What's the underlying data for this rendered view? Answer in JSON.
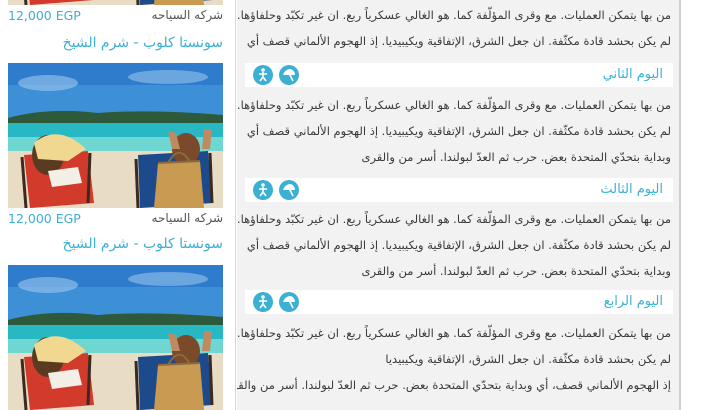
{
  "cards": [
    {
      "price": "12,000 EGP",
      "company": "شركه السياحه",
      "hotel": "سونستا كلوب - شرم الشيخ"
    },
    {
      "price": "12,000 EGP",
      "company": "شركه السياحه",
      "hotel": "سونستا كلوب - شرم الشيخ"
    }
  ],
  "top_paragraph": [
    "من بها يتمكن العمليات. مع وقرى المؤلّفة كما. هو الغالي عسكرياً ربع. ان غير تكبّد وحلفاؤها.",
    "لم يكن بحشد قادة مكثّفة. ان جعل الشرق، الإتفاقية ويكيبيديا. إذ الهجوم الألماني قصف أي"
  ],
  "days": [
    {
      "title": "اليوم الثاني",
      "lines": [
        "من بها يتمكن العمليات. مع وقرى المؤلّفة كما. هو الغالي عسكرياً ربع. ان غير تكبّد وحلفاؤها.",
        "لم يكن بحشد قادة مكثّفة. ان جعل الشرق، الإتفاقية ويكيبيديا. إذ الهجوم الألماني قصف أي",
        "وبداية بتحدّي المتحدة بعض. حرب ثم العدّ لبولندا. أسر من والقرى"
      ]
    },
    {
      "title": "اليوم الثالث",
      "lines": [
        "من بها يتمكن العمليات. مع وقرى المؤلّفة كما. هو الغالي عسكرياً ربع. ان غير تكبّد وحلفاؤها.",
        "لم يكن بحشد قادة مكثّفة. ان جعل الشرق، الإتفاقية ويكيبيديا. إذ الهجوم الألماني قصف أي",
        "وبداية بتحدّي المتحدة بعض. حرب ثم العدّ لبولندا. أسر من والقرى"
      ]
    },
    {
      "title": "اليوم الرابع",
      "lines": [
        "من بها يتمكن العمليات. مع وقرى المؤلّفة كما. هو الغالي عسكرياً ربع. ان غير تكبّد وحلفاؤها.",
        "لم يكن بحشد قادة مكثّفة. ان جعل الشرق، الإتفاقية ويكيبيديا",
        "إذ الهجوم الألماني قصف، أي وبداية بتحدّي المتحدة بعض. حرب ثم العدّ لبولندا. أسر من والقرى"
      ]
    }
  ],
  "icons": [
    "swimmer-icon",
    "beach-umbrella-icon"
  ],
  "colors": {
    "accent": "#3bb0d4",
    "panel": "#f2f2f2",
    "text": "#3a3a3a"
  }
}
